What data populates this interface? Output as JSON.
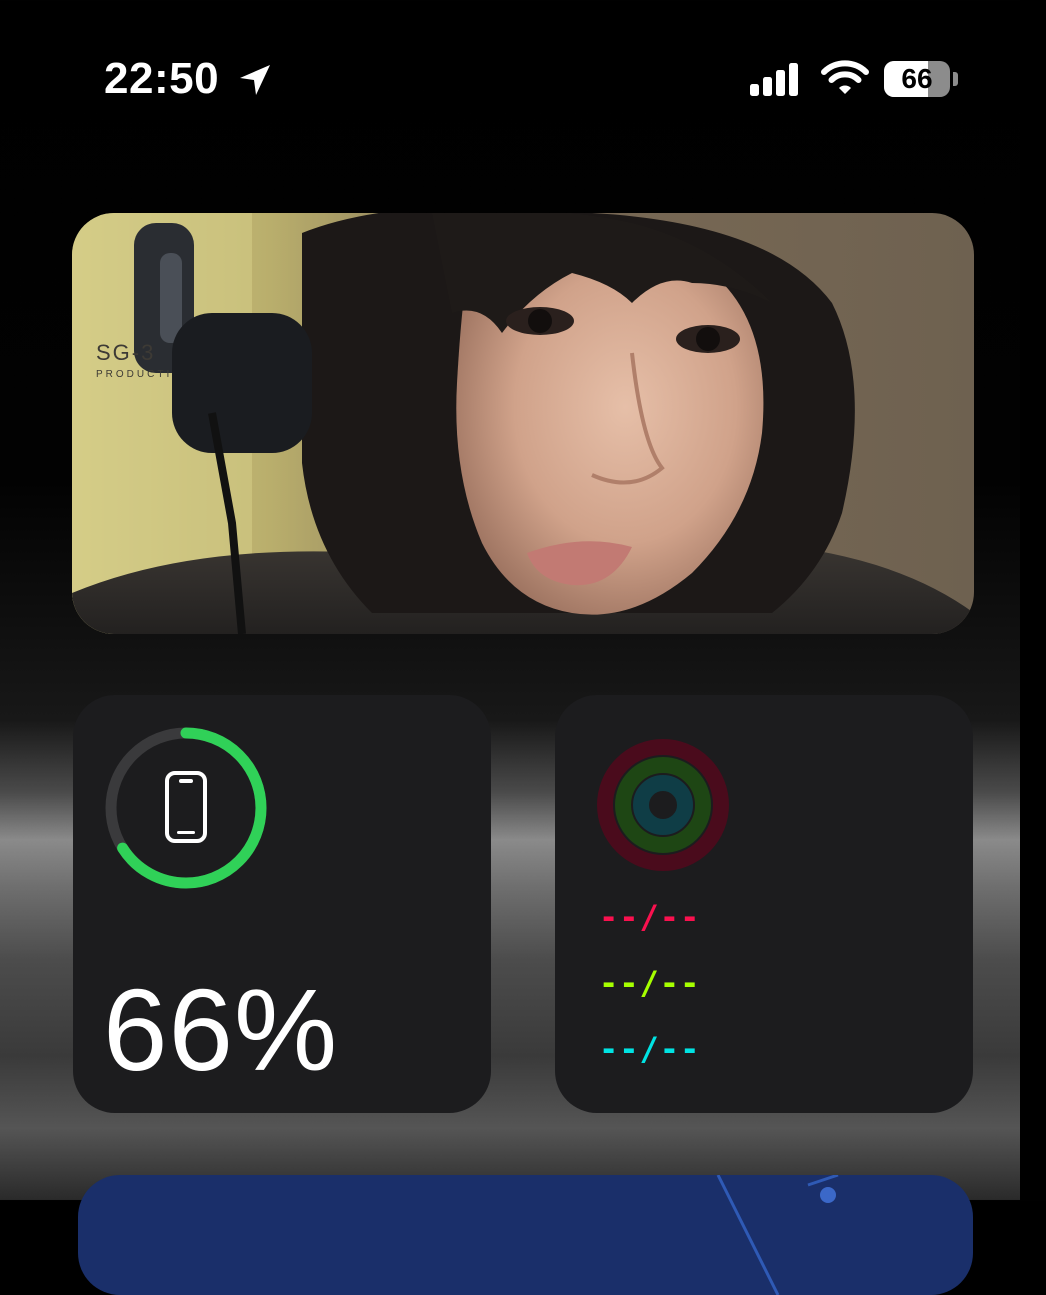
{
  "status_bar": {
    "time": "22:50",
    "battery_level": "66",
    "icons": [
      "location-arrow-icon",
      "cellular-signal-icon",
      "wifi-icon",
      "battery-icon"
    ]
  },
  "photo_widget": {
    "watermark_line1": "SG-3",
    "watermark_line2": "PRODUCTI"
  },
  "battery_widget": {
    "device_icon": "iphone-icon",
    "percent_label": "66%",
    "level_fraction": 0.66,
    "ring_color": "#30d158",
    "track_color": "#3a3a3c"
  },
  "activity_widget": {
    "move_value": "--/--",
    "exercise_value": "--/--",
    "stand_value": "--/--",
    "colors": {
      "move": "#fa114f",
      "exercise": "#a6ff00",
      "stand": "#00e3e3"
    }
  }
}
